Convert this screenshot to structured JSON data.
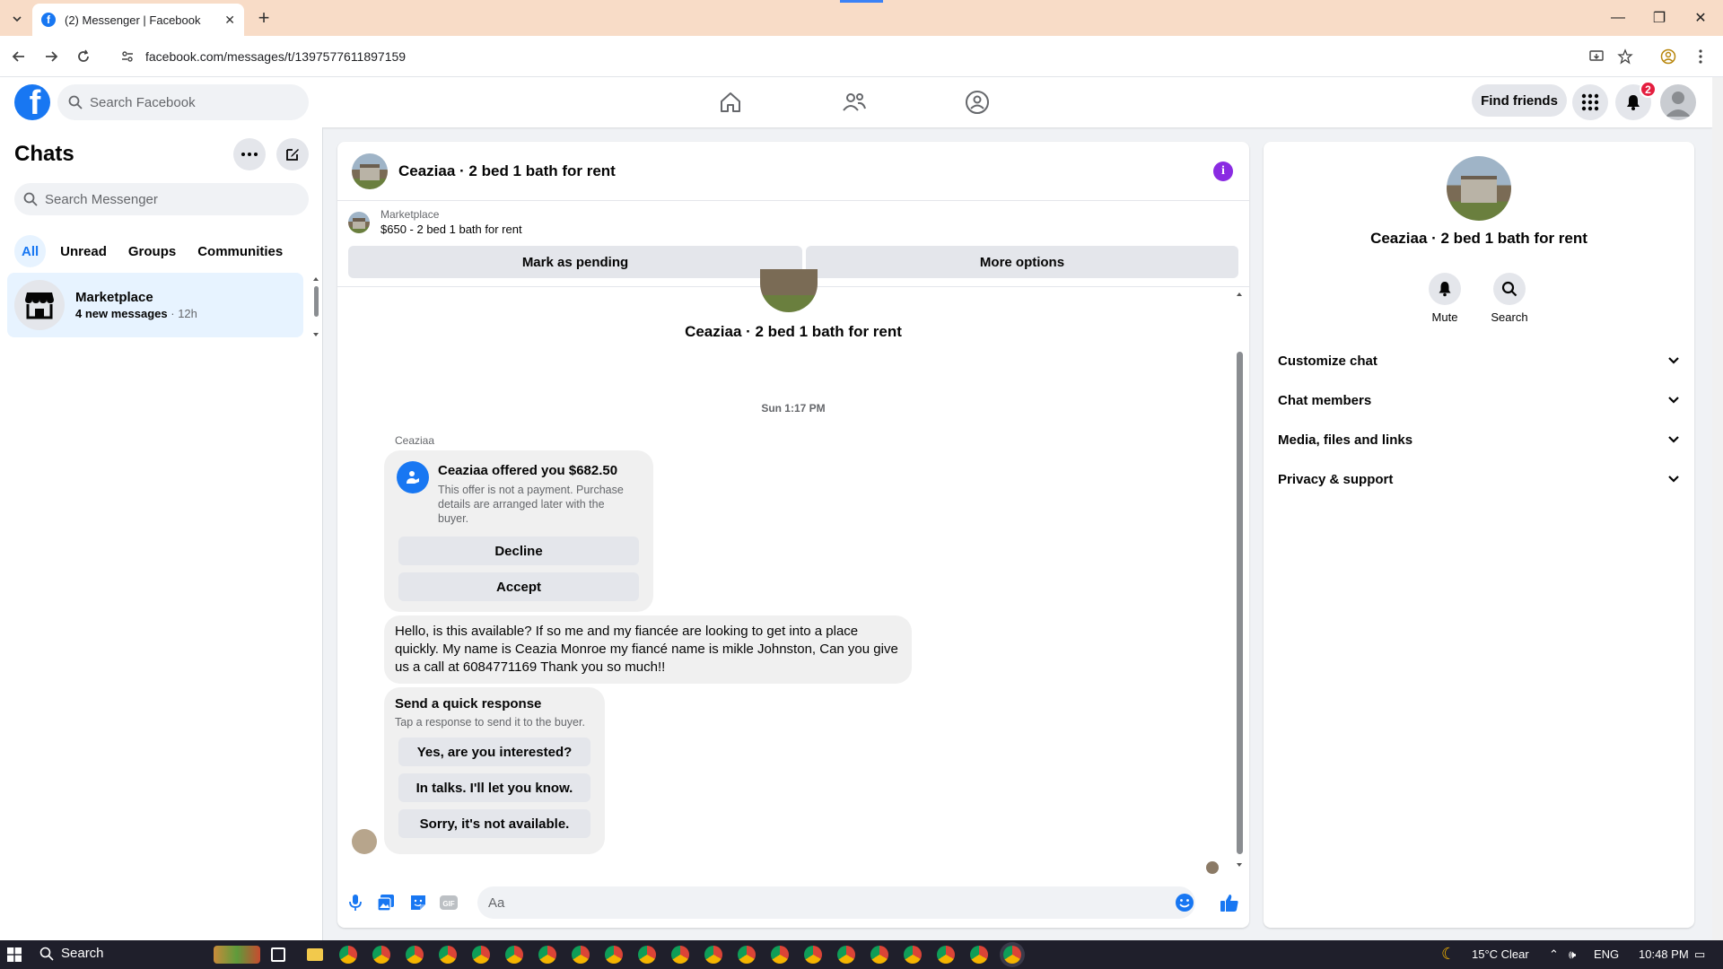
{
  "browser": {
    "tab_title": "(2) Messenger | Facebook",
    "url": "facebook.com/messages/t/1397577611897159"
  },
  "fb_header": {
    "search_placeholder": "Search Facebook",
    "find_friends": "Find friends",
    "notification_count": "2"
  },
  "chats": {
    "title": "Chats",
    "search_placeholder": "Search Messenger",
    "filters": [
      "All",
      "Unread",
      "Groups",
      "Communities"
    ],
    "active_filter": "All",
    "items": [
      {
        "name": "Marketplace",
        "preview": "4 new messages",
        "time": "12h"
      }
    ]
  },
  "conversation": {
    "title": "Ceaziaa · 2 bed 1 bath for rent",
    "marketplace_label": "Marketplace",
    "listing": "$650 - 2 bed 1 bath for rent",
    "mark_pending": "Mark as pending",
    "more_options": "More options",
    "timestamp": "Sun 1:17 PM",
    "sender": "Ceaziaa",
    "offer": {
      "title": "Ceaziaa offered you $682.50",
      "description": "This offer is not a payment. Purchase details are arranged later with the buyer.",
      "decline": "Decline",
      "accept": "Accept"
    },
    "message": "Hello, is this available? If so me and my fiancée are looking to get into a place quickly. My name is Ceazia Monroe my fiancé name is mikle Johnston, Can you give us a call at 6084771169 Thank you so much!!",
    "quick_response": {
      "title": "Send a quick response",
      "subtitle": "Tap a response to send it to the buyer.",
      "options": [
        "Yes, are you interested?",
        "In talks. I'll let you know.",
        "Sorry, it's not available."
      ]
    },
    "composer_placeholder": "Aa"
  },
  "info_panel": {
    "title": "Ceaziaa · 2 bed 1 bath for rent",
    "mute": "Mute",
    "search": "Search",
    "sections": [
      "Customize chat",
      "Chat members",
      "Media, files and links",
      "Privacy & support"
    ]
  },
  "taskbar": {
    "search": "Search",
    "weather": "15°C  Clear",
    "language": "ENG",
    "time": "10:48 PM"
  },
  "colors": {
    "brand_blue": "#1877f2",
    "accent_purple": "#8a2be2",
    "tab_bar": "#f8dcc7"
  }
}
